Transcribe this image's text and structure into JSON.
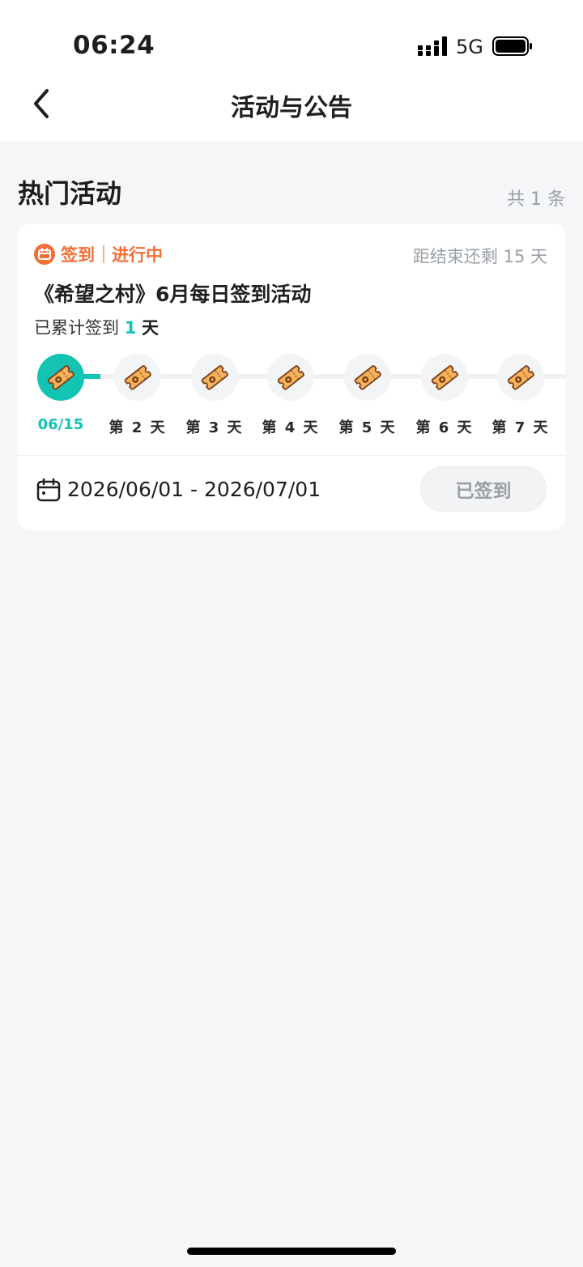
{
  "status_bar": {
    "time": "06:24",
    "network": "5G"
  },
  "nav": {
    "title": "活动与公告"
  },
  "section": {
    "title": "热门活动",
    "count": "共 1 条"
  },
  "card": {
    "tag_label": "签到",
    "tag_status": "进行中",
    "countdown": "距结束还剩 15 天",
    "title": "《希望之村》6月每日签到活动",
    "progress_prefix": "已累计签到",
    "progress_count": "1",
    "progress_unit": "天",
    "days": [
      {
        "label": "06/15",
        "active": true
      },
      {
        "label": "第 2 天",
        "active": false
      },
      {
        "label": "第 3 天",
        "active": false
      },
      {
        "label": "第 4 天",
        "active": false
      },
      {
        "label": "第 5 天",
        "active": false
      },
      {
        "label": "第 6 天",
        "active": false
      },
      {
        "label": "第 7 天",
        "active": false
      }
    ],
    "date_range": "2026/06/01 - 2026/07/01",
    "button_label": "已签到"
  },
  "colors": {
    "accent_teal": "#14c4b3",
    "accent_orange": "#f26f37"
  },
  "icons": {
    "back": "chevron-left-icon",
    "tag": "checkin-calendar-icon",
    "day": "ticket-icon",
    "calendar": "calendar-icon"
  }
}
